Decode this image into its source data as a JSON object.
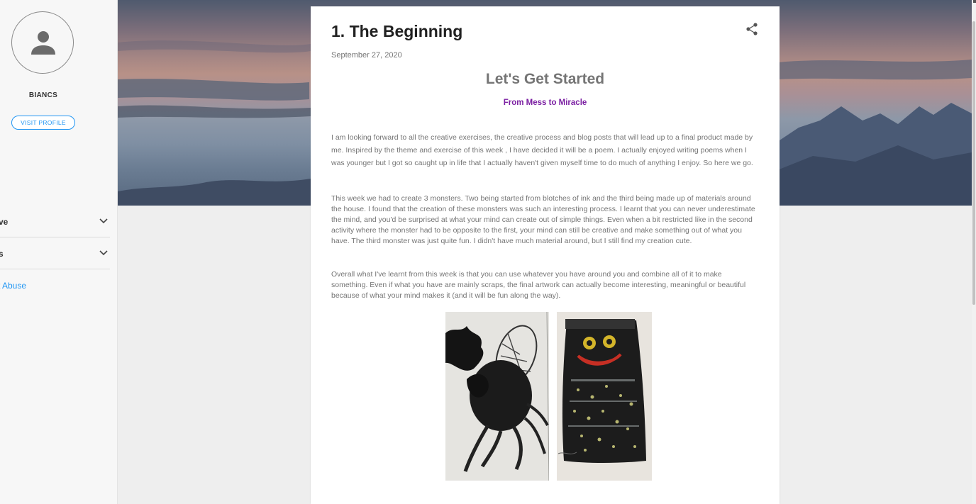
{
  "sidebar": {
    "profile_name": "BIANCS",
    "visit_profile_label": "VISIT PROFILE",
    "sections": [
      {
        "label": "ve"
      },
      {
        "label": "s"
      }
    ],
    "report_abuse_label": "t Abuse"
  },
  "post": {
    "title": "1. The Beginning",
    "date": "September 27, 2020",
    "headline": "Let's Get Started",
    "subheadline": "From Mess to Miracle",
    "paragraphs": [
      "I am looking forward to all the creative exercises, the creative process and blog posts that will lead up to a final product made by me. Inspired by the theme and exercise of this week , I have decided it will be a poem. I actually enjoyed writing poems when I was younger but I got so caught up in life that I actually haven't given myself time to do much of anything I enjoy. So here we go.",
      "This week we had to create 3 monsters. Two being started from blotches of ink and the third being made up of materials around the house. I found that the creation of these monsters was such an interesting process. I learnt that you can never underestimate the mind, and you'd be surprised at what your mind can create out of simple things. Even when a bit restricted like in the second activity where the monster had to be opposite to the first, your mind can still be creative and make something out of what you have. The third monster was just quite fun. I didn't have much material around, but I still find my creation cute.",
      "Overall what I've learnt from this week is that you can use whatever you have around you and combine all of it to make something. Even if what you have are mainly scraps, the final artwork can actually become interesting, meaningful or beautiful because of what your mind makes it (and it will be fun along the way)."
    ],
    "images": [
      {
        "icon": "ink-fly-monster-drawing"
      },
      {
        "icon": "black-robot-monster-painting"
      }
    ]
  },
  "colors": {
    "accent_blue": "#2196f3",
    "subheadline_purple": "#7b1fa2",
    "body_text": "#757575",
    "title_text": "#212121"
  }
}
